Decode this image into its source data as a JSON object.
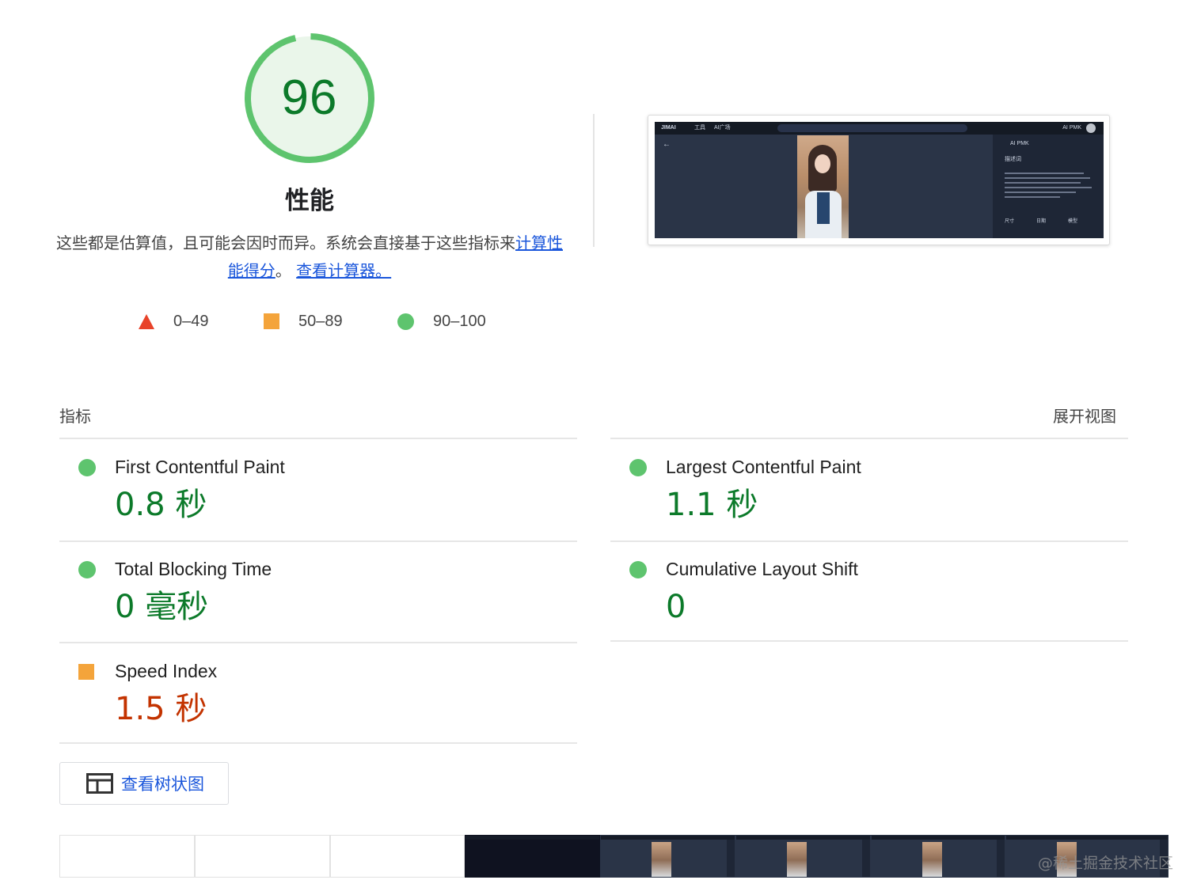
{
  "score": {
    "value": "96",
    "category": "性能",
    "color_good": "#0c7a2a",
    "ring_color": "#5ec46e",
    "fill_color": "#eaf6ea",
    "fraction": 0.96
  },
  "description": {
    "text": "这些都是估算值，且可能会因时而异。系统会直接基于这些指标来",
    "link1": "计算性能得分",
    "sep": "。",
    "link2": "查看计算器。"
  },
  "legend": [
    {
      "shape": "triangle",
      "label": "0–49",
      "color": "#e8432a"
    },
    {
      "shape": "square",
      "label": "50–89",
      "color": "#f4a43b"
    },
    {
      "shape": "circle",
      "label": "90–100",
      "color": "#5ec46e"
    }
  ],
  "final_screenshot": {
    "app_logo": "JIMAI",
    "nav1": "工具",
    "nav2": "AI广场",
    "user": "AI PMK",
    "panel_user": "AI PMK",
    "panel_heading": "描述词",
    "panel_meta1": "尺寸",
    "panel_meta2": "日期",
    "panel_meta3": "模型"
  },
  "metrics": {
    "title": "指标",
    "expand": "展开视图",
    "items": [
      {
        "name": "First Contentful Paint",
        "value": "0.8 秒",
        "rating": "good"
      },
      {
        "name": "Largest Contentful Paint",
        "value": "1.1 秒",
        "rating": "good"
      },
      {
        "name": "Total Blocking Time",
        "value": "0 毫秒",
        "rating": "good"
      },
      {
        "name": "Cumulative Layout Shift",
        "value": "0",
        "rating": "good"
      },
      {
        "name": "Speed Index",
        "value": "1.5 秒",
        "rating": "average"
      }
    ]
  },
  "treemap_button": {
    "label": "查看树状图",
    "icon": "treemap-icon"
  },
  "filmstrip": {
    "frames": [
      "blank",
      "blank",
      "blank",
      "dark",
      "app",
      "app",
      "app",
      "app"
    ]
  },
  "watermark": "@稀土掘金技术社区"
}
